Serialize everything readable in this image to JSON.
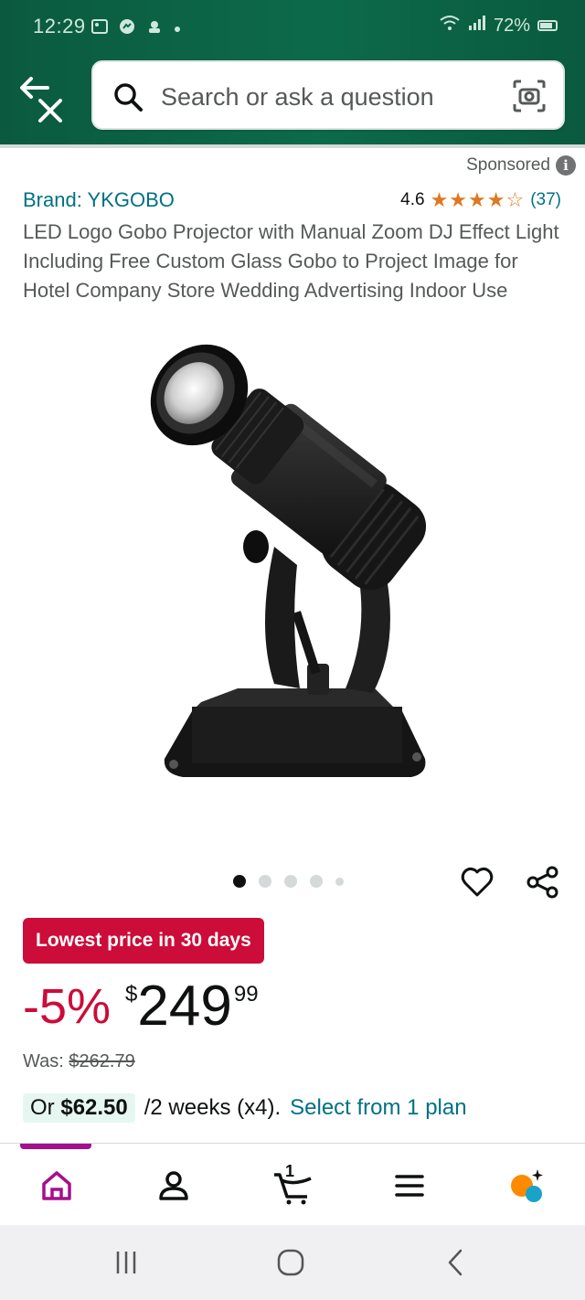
{
  "status_bar": {
    "time": "12:29",
    "battery": "72%"
  },
  "search": {
    "placeholder": "Search or ask a question"
  },
  "sponsored_label": "Sponsored",
  "product": {
    "brand": "Brand: YKGOBO",
    "rating": "4.6",
    "stars": "★★★★☆",
    "review_count": "(37)",
    "title": "LED Logo Gobo Projector with Manual Zoom DJ Effect Light Including Free Custom Glass Gobo to Project Image for Hotel Company Store Wedding Advertising Indoor Use",
    "image_count": 5,
    "active_image": 1
  },
  "deal": {
    "badge": "Lowest price in 30 days",
    "discount": "-5%",
    "price_symbol": "$",
    "price_whole": "249",
    "price_fraction": "99",
    "was_label": "Was:",
    "was_price": "$262.79"
  },
  "installment": {
    "prefix": "Or",
    "amount": "$62.50",
    "terms": "/2 weeks (x4).",
    "link": "Select from 1 plan"
  },
  "bottom_nav": {
    "cart_count": "1",
    "items": [
      "home-icon",
      "account-icon",
      "cart-icon",
      "menu-icon",
      "rufus-icon"
    ]
  },
  "colors": {
    "header": "#0c6a4a",
    "link": "#007185",
    "deal_red": "#cc0c39",
    "star_orange": "#de7921",
    "nav_accent": "#a50f8e"
  }
}
